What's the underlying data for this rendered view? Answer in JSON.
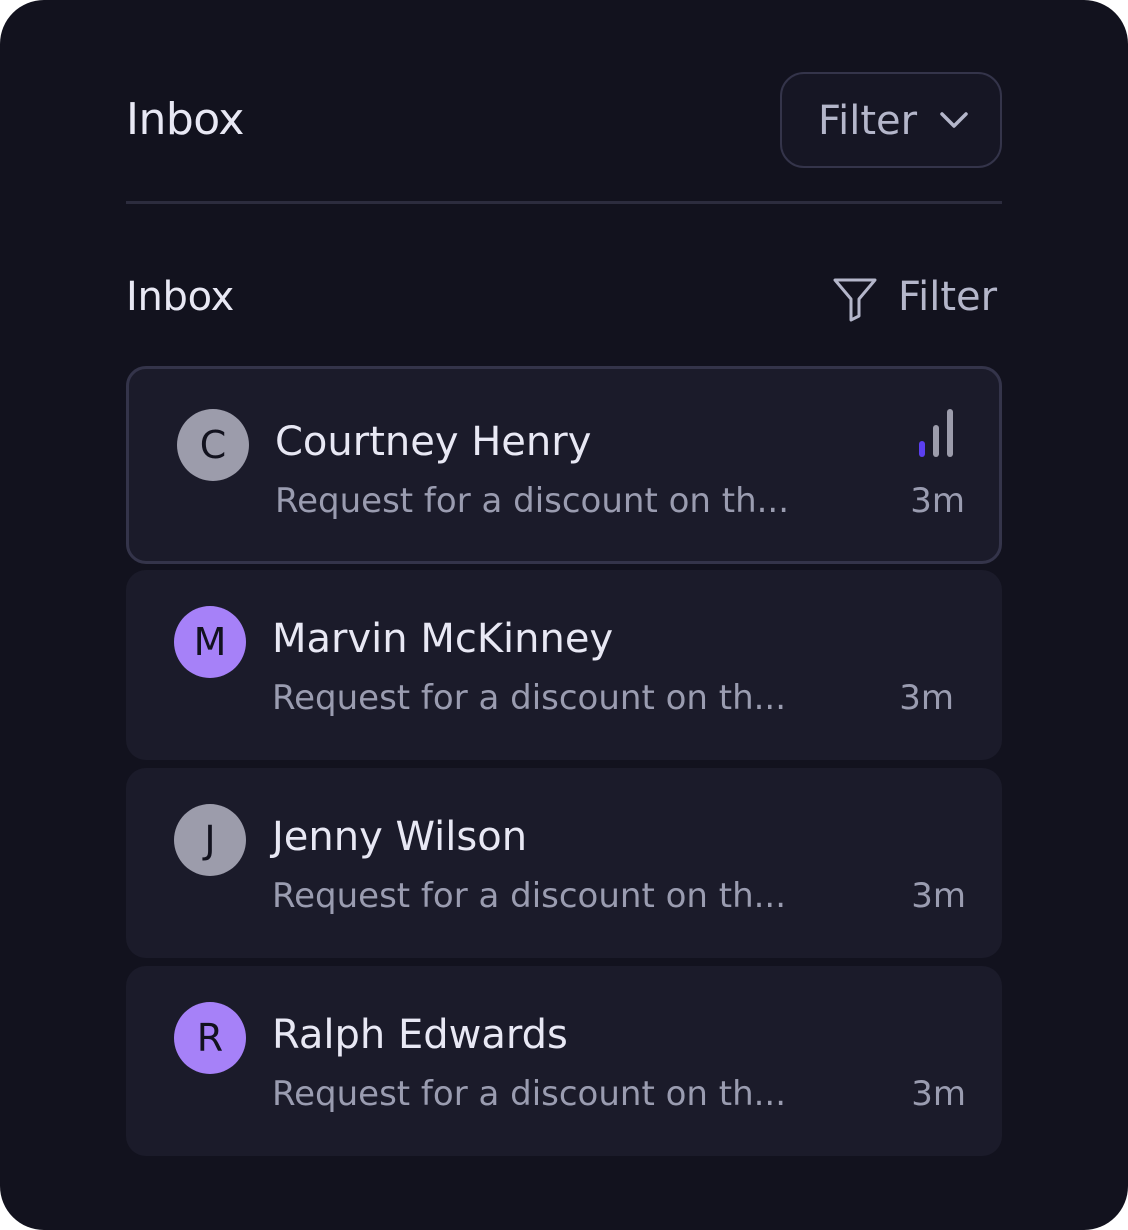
{
  "header": {
    "title": "Inbox",
    "filter_label": "Filter",
    "filter_icon": "chevron-down-icon"
  },
  "subheader": {
    "title": "Inbox",
    "filter_label": "Filter",
    "filter_icon": "funnel-icon"
  },
  "messages": [
    {
      "initial": "C",
      "name": "Courtney Henry",
      "preview": "Request for a discount on th...",
      "time": "3m",
      "avatar_color": "#9c9cab",
      "selected": true,
      "priority_icon": "signal-bars-icon",
      "priority_level": 1,
      "priority_max": 3
    },
    {
      "initial": "M",
      "name": "Marvin McKinney",
      "preview": "Request for a discount on th...",
      "time": "3m",
      "avatar_color": "#a681f8",
      "selected": false
    },
    {
      "initial": "J",
      "name": "Jenny Wilson",
      "preview": "Request for a discount on th...",
      "time": "3m",
      "avatar_color": "#9c9cab",
      "selected": false
    },
    {
      "initial": "R",
      "name": "Ralph Edwards",
      "preview": "Request for a discount on th...",
      "time": "3m",
      "avatar_color": "#a681f8",
      "selected": false
    }
  ],
  "colors": {
    "background": "#12121e",
    "row_background": "#1b1b2a",
    "border": "#34344a",
    "accent": "#5b3ff0",
    "text_primary": "#e8e8f4",
    "text_secondary": "#9a9cb0"
  }
}
